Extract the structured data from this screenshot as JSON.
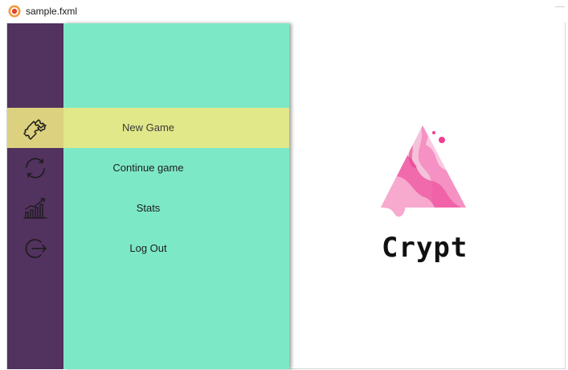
{
  "window": {
    "title": "sample.fxml"
  },
  "menu": {
    "items": [
      {
        "id": "new-game",
        "label": "New Game",
        "icon": "puzzle-icon",
        "active": true
      },
      {
        "id": "continue-game",
        "label": "Continue game",
        "icon": "refresh-icon",
        "active": false
      },
      {
        "id": "stats",
        "label": "Stats",
        "icon": "bar-chart-icon",
        "active": false
      },
      {
        "id": "log-out",
        "label": "Log Out",
        "icon": "logout-icon",
        "active": false
      }
    ]
  },
  "brand": {
    "name": "Crypt",
    "logo": "triangle-logo"
  },
  "colors": {
    "rail": "#52325e",
    "panel": "#7de8c6",
    "active_row": "#e1e88a",
    "active_icon_cell": "#dcd17f",
    "logo_pink": "#f0559e"
  }
}
